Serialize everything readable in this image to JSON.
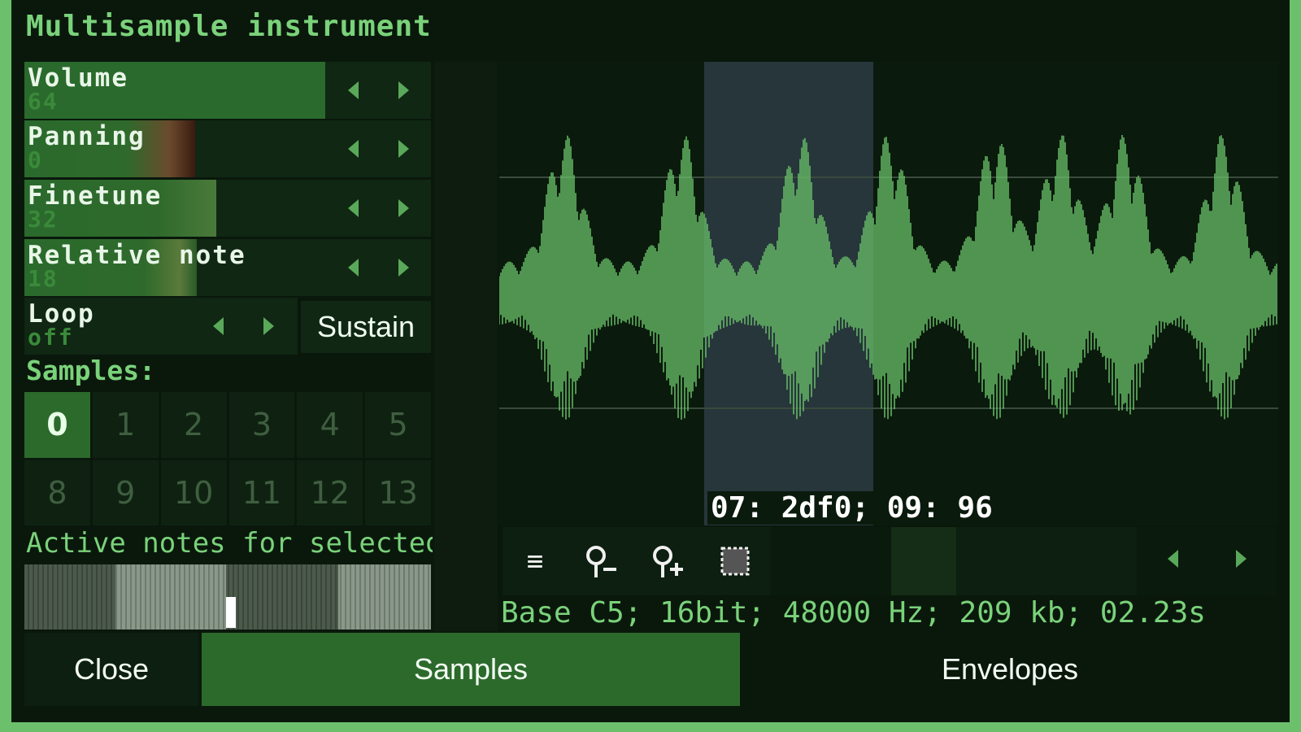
{
  "title": "Multisample instrument",
  "params": [
    {
      "name": "Volume",
      "value": "64",
      "level": 0.74
    },
    {
      "name": "Panning",
      "value": "0",
      "level": 0.37
    },
    {
      "name": "Finetune",
      "value": "32",
      "level": 0.47
    },
    {
      "name": "Relative note",
      "value": "18",
      "level": 0.42
    }
  ],
  "loop": {
    "name": "Loop",
    "value": "off"
  },
  "sustain_label": "Sustain",
  "samples_label": "Samples:",
  "samples": [
    "0",
    "1",
    "2",
    "3",
    "4",
    "5",
    "8",
    "9",
    "10",
    "11",
    "12",
    "13"
  ],
  "active_sample": "0",
  "active_notes_label": "Active notes for selected",
  "waveform": {
    "selection_text": "07: 2df0; 09: 96"
  },
  "toolbar": {
    "icons": [
      "menu-icon",
      "zoom-out-icon",
      "zoom-in-icon",
      "select-all-icon"
    ]
  },
  "info_text": "Base C5; 16bit; 48000 Hz; 209 kb; 02.23s",
  "tabs": [
    "Close",
    "Samples",
    "Envelopes"
  ],
  "active_tab": "Samples",
  "colors": {
    "accent": "#6cc06c",
    "active": "#2c6a2c",
    "background": "#0a180c",
    "wave": "#6bc46b"
  }
}
